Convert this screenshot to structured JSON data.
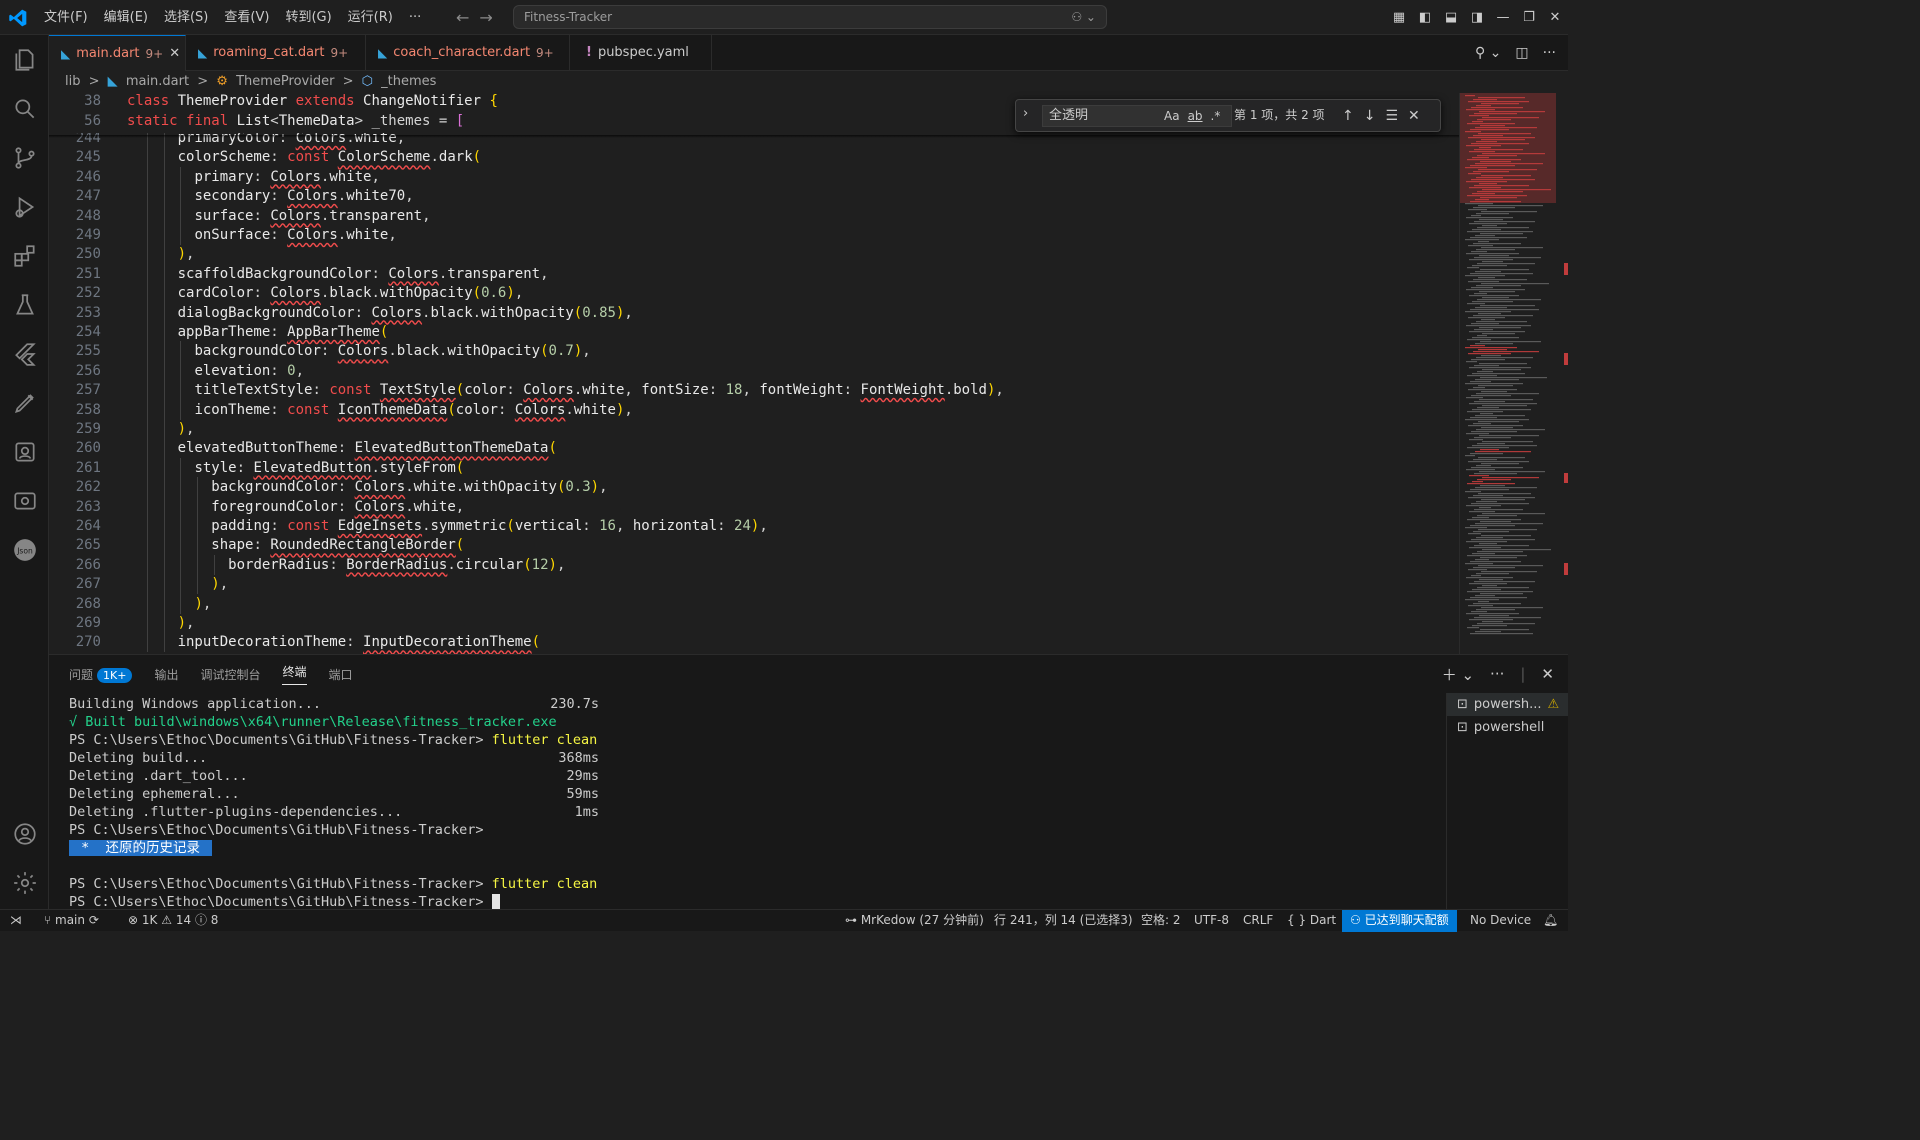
{
  "menu": [
    "文件(F)",
    "编辑(E)",
    "选择(S)",
    "查看(V)",
    "转到(G)",
    "运行(R)",
    "···"
  ],
  "search_box": "Fitness-Tracker",
  "tabs": [
    {
      "label": "main.dart",
      "count": "9+",
      "active": true,
      "close": "✕"
    },
    {
      "label": "roaming_cat.dart",
      "count": "9+"
    },
    {
      "label": "coach_character.dart",
      "count": "9+"
    },
    {
      "label": "pubspec.yaml",
      "icon": "!"
    }
  ],
  "breadcrumb": [
    "lib",
    ">",
    "main.dart",
    ">",
    "ThemeProvider",
    ">",
    "_themes"
  ],
  "sticky": [
    {
      "ln": "38",
      "text": "class ThemeProvider extends ChangeNotifier {"
    },
    {
      "ln": "56",
      "text": "  static final List<ThemeData> _themes = ["
    }
  ],
  "code_lines": [
    {
      "ln": "244",
      "text": "      primaryColor: Colors.white,"
    },
    {
      "ln": "245",
      "text": "      colorScheme: const ColorScheme.dark("
    },
    {
      "ln": "246",
      "text": "        primary: Colors.white,"
    },
    {
      "ln": "247",
      "text": "        secondary: Colors.white70,"
    },
    {
      "ln": "248",
      "text": "        surface: Colors.transparent,"
    },
    {
      "ln": "249",
      "text": "        onSurface: Colors.white,"
    },
    {
      "ln": "250",
      "text": "      ),"
    },
    {
      "ln": "251",
      "text": "      scaffoldBackgroundColor: Colors.transparent,"
    },
    {
      "ln": "252",
      "text": "      cardColor: Colors.black.withOpacity(0.6),"
    },
    {
      "ln": "253",
      "text": "      dialogBackgroundColor: Colors.black.withOpacity(0.85),"
    },
    {
      "ln": "254",
      "text": "      appBarTheme: AppBarTheme("
    },
    {
      "ln": "255",
      "text": "        backgroundColor: Colors.black.withOpacity(0.7),"
    },
    {
      "ln": "256",
      "text": "        elevation: 0,"
    },
    {
      "ln": "257",
      "text": "        titleTextStyle: const TextStyle(color: Colors.white, fontSize: 18, fontWeight: FontWeight.bold),"
    },
    {
      "ln": "258",
      "text": "        iconTheme: const IconThemeData(color: Colors.white),"
    },
    {
      "ln": "259",
      "text": "      ),"
    },
    {
      "ln": "260",
      "text": "      elevatedButtonTheme: ElevatedButtonThemeData("
    },
    {
      "ln": "261",
      "text": "        style: ElevatedButton.styleFrom("
    },
    {
      "ln": "262",
      "text": "          backgroundColor: Colors.white.withOpacity(0.3),"
    },
    {
      "ln": "263",
      "text": "          foregroundColor: Colors.white,"
    },
    {
      "ln": "264",
      "text": "          padding: const EdgeInsets.symmetric(vertical: 16, horizontal: 24),"
    },
    {
      "ln": "265",
      "text": "          shape: RoundedRectangleBorder("
    },
    {
      "ln": "266",
      "text": "            borderRadius: BorderRadius.circular(12),"
    },
    {
      "ln": "267",
      "text": "          ),"
    },
    {
      "ln": "268",
      "text": "        ),"
    },
    {
      "ln": "269",
      "text": "      ),"
    },
    {
      "ln": "270",
      "text": "      inputDecorationTheme: InputDecorationTheme("
    }
  ],
  "find": {
    "value": "全透明",
    "aa": "Aa",
    "ab": "ab",
    "regex": ".*",
    "count": "第 1 项，共 2 项"
  },
  "panel_tabs": [
    "问题",
    "输出",
    "调试控制台",
    "终端",
    "端口"
  ],
  "problems_badge": "1K+",
  "terminal": [
    {
      "text": "Building Windows application...",
      "right": "230.7s"
    },
    {
      "text": "√ Built build\\windows\\x64\\runner\\Release\\fitness_tracker.exe",
      "cls": "green"
    },
    {
      "prompt": "PS C:\\Users\\Ethoc\\Documents\\GitHub\\Fitness-Tracker> ",
      "cmd": "flutter clean"
    },
    {
      "text": "Deleting build...",
      "right": "368ms"
    },
    {
      "text": "Deleting .dart_tool...",
      "right": "29ms"
    },
    {
      "text": "Deleting ephemeral...",
      "right": "59ms"
    },
    {
      "text": "Deleting .flutter-plugins-dependencies...",
      "right": "1ms"
    },
    {
      "prompt": "PS C:\\Users\\Ethoc\\Documents\\GitHub\\Fitness-Tracker>"
    },
    {
      "hist": " *  还原的历史记录 "
    },
    {
      "text": ""
    },
    {
      "prompt": "PS C:\\Users\\Ethoc\\Documents\\GitHub\\Fitness-Tracker> ",
      "cmd": "flutter clean"
    },
    {
      "prompt": "PS C:\\Users\\Ethoc\\Documents\\GitHub\\Fitness-Tracker> ",
      "cursor": true
    }
  ],
  "terminal_list": [
    "powersh...",
    "powershell"
  ],
  "status": {
    "branch": "main",
    "errors": "1K",
    "warnings": "14",
    "info": "8",
    "blame": "MrKedow (27 分钟前)",
    "position": "行 241，列 14 (已选择3)",
    "spaces": "空格: 2",
    "encoding": "UTF-8",
    "eol": "CRLF",
    "lang": "Dart",
    "copilot": "已达到聊天配额",
    "device": "No Device"
  }
}
